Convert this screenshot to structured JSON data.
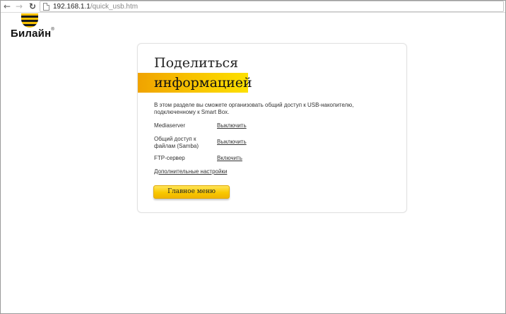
{
  "browser": {
    "url_host": "192.168.1.1",
    "url_path": "/quick_usb.htm",
    "back_icon": "arrow-left-icon",
    "forward_icon": "arrow-right-icon",
    "reload_icon": "reload-icon"
  },
  "logo": {
    "text": "Билайн",
    "reg": "®",
    "colors": {
      "yellow": "#f7c100",
      "black": "#1a1a1a"
    }
  },
  "card": {
    "title_line1": "Поделиться",
    "title_line2": "информацией",
    "description": "В этом разделе вы сможете организовать общий доступ к USB-накопителю, подключенному к Smart Box.",
    "rows": [
      {
        "label": "Mediaserver",
        "action": "Выключить"
      },
      {
        "label_line1": "Общий доступ к",
        "label_line2": "файлам (Samba)",
        "action": "Выключить"
      },
      {
        "label": "FTP-сервер",
        "action": "Включить"
      }
    ],
    "advanced_link": "Дополнительные настройки",
    "main_button": "Главное меню",
    "accent_color": "#f7c000"
  }
}
